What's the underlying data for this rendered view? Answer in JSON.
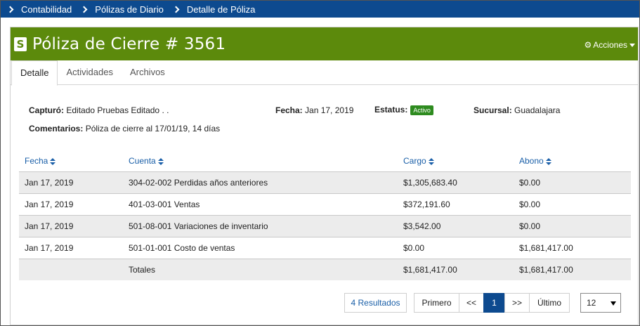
{
  "breadcrumb": [
    "Contabilidad",
    "Pólizas de Diario",
    "Detalle de Póliza"
  ],
  "header": {
    "title": "Póliza de Cierre # 3561",
    "actions_label": "Acciones",
    "logo_letter": "S"
  },
  "tabs": [
    {
      "label": "Detalle",
      "active": true
    },
    {
      "label": "Actividades",
      "active": false
    },
    {
      "label": "Archivos",
      "active": false
    }
  ],
  "info": {
    "capturo_label": "Capturó:",
    "capturo_value": "Editado Pruebas Editado . .",
    "fecha_label": "Fecha:",
    "fecha_value": "Jan 17, 2019",
    "estatus_label": "Estatus:",
    "estatus_value": "Activo",
    "sucursal_label": "Sucursal:",
    "sucursal_value": "Guadalajara",
    "comentarios_label": "Comentarios:",
    "comentarios_value": "Póliza de cierre al 17/01/19, 14 días"
  },
  "table": {
    "columns": [
      "Fecha",
      "Cuenta",
      "Cargo",
      "Abono"
    ],
    "rows": [
      [
        "Jan 17, 2019",
        "304-02-002 Perdidas años anteriores",
        "$1,305,683.40",
        "$0.00"
      ],
      [
        "Jan 17, 2019",
        "401-03-001 Ventas",
        "$372,191.60",
        "$0.00"
      ],
      [
        "Jan 17, 2019",
        "501-08-001 Variaciones de inventario",
        "$3,542.00",
        "$0.00"
      ],
      [
        "Jan 17, 2019",
        "501-01-001 Costo de ventas",
        "$0.00",
        "$1,681,417.00"
      ]
    ],
    "totals": {
      "label": "Totales",
      "cargo": "$1,681,417.00",
      "abono": "$1,681,417.00"
    }
  },
  "pagination": {
    "results_label": "4 Resultados",
    "first": "Primero",
    "prev": "<<",
    "current": "1",
    "next": ">>",
    "last": "Último",
    "page_size": "12"
  },
  "colors": {
    "breadcrumb_bg": "#0d4a8f",
    "header_bg": "#5c8a0c",
    "status_badge": "#2e8b1f",
    "link": "#1a5fa8"
  }
}
